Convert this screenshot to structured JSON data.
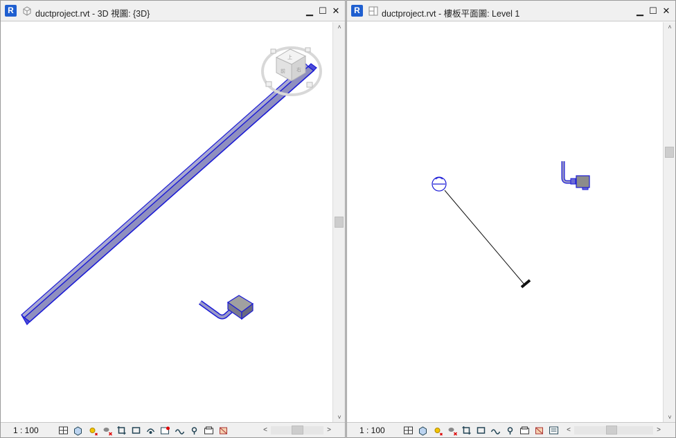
{
  "left_window": {
    "title": "ductproject.rvt - 3D 視圖: {3D}",
    "view_type_icon": "3d-view-icon",
    "scale": "1 : 100",
    "controls": {
      "minimize": "▁",
      "maximize": "☐",
      "close": "✕"
    },
    "viewcube": {
      "top_face": "上",
      "front_face": "前",
      "right_face": "右"
    }
  },
  "right_window": {
    "title": "ductproject.rvt - 樓板平面圖: Level 1",
    "view_type_icon": "floor-plan-icon",
    "scale": "1 : 100",
    "controls": {
      "minimize": "▁",
      "maximize": "☐",
      "close": "✕"
    }
  },
  "app_icon_label": "R",
  "scroll_arrows": {
    "up": "˄",
    "down": "˅",
    "left": "<",
    "right": ">"
  },
  "view_control_icons": [
    "detail-level-icon",
    "visual-style-icon",
    "sun-path-icon",
    "shadows-icon",
    "crop-view-icon",
    "show-crop-region-icon",
    "temporary-hide-icon",
    "reveal-hidden-icon",
    "worksharing-display-icon",
    "analytical-model-icon",
    "highlight-displacement-icon",
    "reveal-constraints-icon"
  ],
  "colors": {
    "duct_outline": "#1a1ad6",
    "duct_fill": "#8c8cb8",
    "titlebar_bg": "#f0f0f0",
    "app_icon": "#1f5fd0"
  }
}
